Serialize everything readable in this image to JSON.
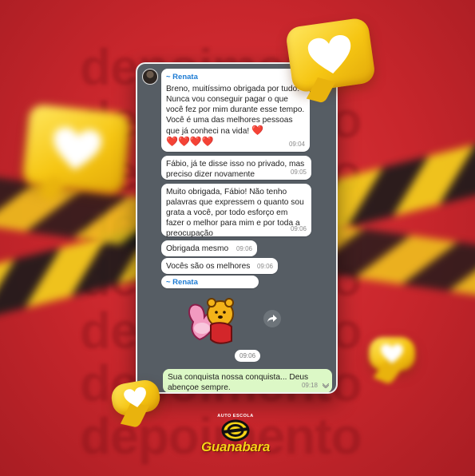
{
  "background": {
    "word": "depoimento",
    "colors": {
      "red": "#c8262c",
      "tape_yellow": "#f4d31c",
      "tape_black": "#1b1b1b"
    }
  },
  "chat": {
    "messages": [
      {
        "sender": "~ Renata",
        "text": "Breno, muitíssimo obrigada por tudo. Nunca vou conseguir pagar o que você fez por mim durante esse tempo. Você é uma das melhores pessoas que já conheci na vida!",
        "hearts_inline": "❤️",
        "hearts_line": "❤️❤️❤️❤️",
        "time": "09:04"
      },
      {
        "text": "Fábio, já te disse isso no privado, mas preciso dizer novamente",
        "time": "09:05"
      },
      {
        "text": "Muito obrigada, Fábio! Não tenho palavras que expressem o quanto sou grata a você, por todo esforço em fazer o melhor para mim e por toda a preocupação",
        "time": "09:06"
      },
      {
        "text": "Obrigada mesmo",
        "time": "09:06"
      },
      {
        "text": "Vocês são os melhores",
        "time": "09:06"
      }
    ],
    "sticker_sender": "~ Renata",
    "sticker_icon": "winnie-the-pooh-sticker",
    "sticker_time": "09:06",
    "sent_message": {
      "text": "Sua conquista nossa conquista... Deus abençoe sempre.",
      "time": "09:18"
    },
    "colors": {
      "bubble_in": "#ffffff",
      "bubble_out": "#dcf8c6",
      "sender_name": "#1d7bd3",
      "chat_bg": "#565d64"
    }
  },
  "logo": {
    "tagline": "AUTO ESCOLA",
    "name": "Guanabara",
    "colors": {
      "yellow": "#f5d417",
      "black": "#111111"
    }
  }
}
